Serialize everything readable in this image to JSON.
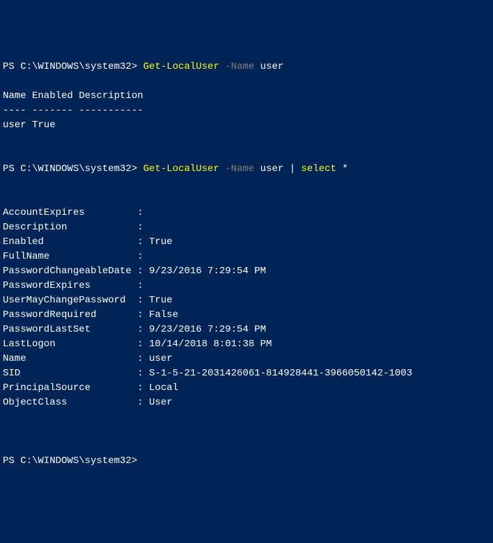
{
  "prompt1": {
    "prefix": "PS C:\\WINDOWS\\system32> ",
    "cmdlet": "Get-LocalUser",
    "param": " -Name",
    "arg": " user"
  },
  "table1": {
    "header": "Name Enabled Description",
    "divider": "---- ------- -----------",
    "row": "user True"
  },
  "prompt2": {
    "prefix": "PS C:\\WINDOWS\\system32> ",
    "cmdlet": "Get-LocalUser",
    "param": " -Name",
    "arg": " user ",
    "pipe": "| ",
    "cmdlet2": "select ",
    "wildcard": "*"
  },
  "props": {
    "l01": "AccountExpires         :",
    "l02": "Description            :",
    "l03": "Enabled                : True",
    "l04": "FullName               :",
    "l05": "PasswordChangeableDate : 9/23/2016 7:29:54 PM",
    "l06": "PasswordExpires        :",
    "l07": "UserMayChangePassword  : True",
    "l08": "PasswordRequired       : False",
    "l09": "PasswordLastSet        : 9/23/2016 7:29:54 PM",
    "l10": "LastLogon              : 10/14/2018 8:01:38 PM",
    "l11": "Name                   : user",
    "l12": "SID                    : S-1-5-21-2031426061-814928441-3966050142-1003",
    "l13": "PrincipalSource        : Local",
    "l14": "ObjectClass            : User"
  },
  "prompt3": {
    "prefix": "PS C:\\WINDOWS\\system32>"
  }
}
